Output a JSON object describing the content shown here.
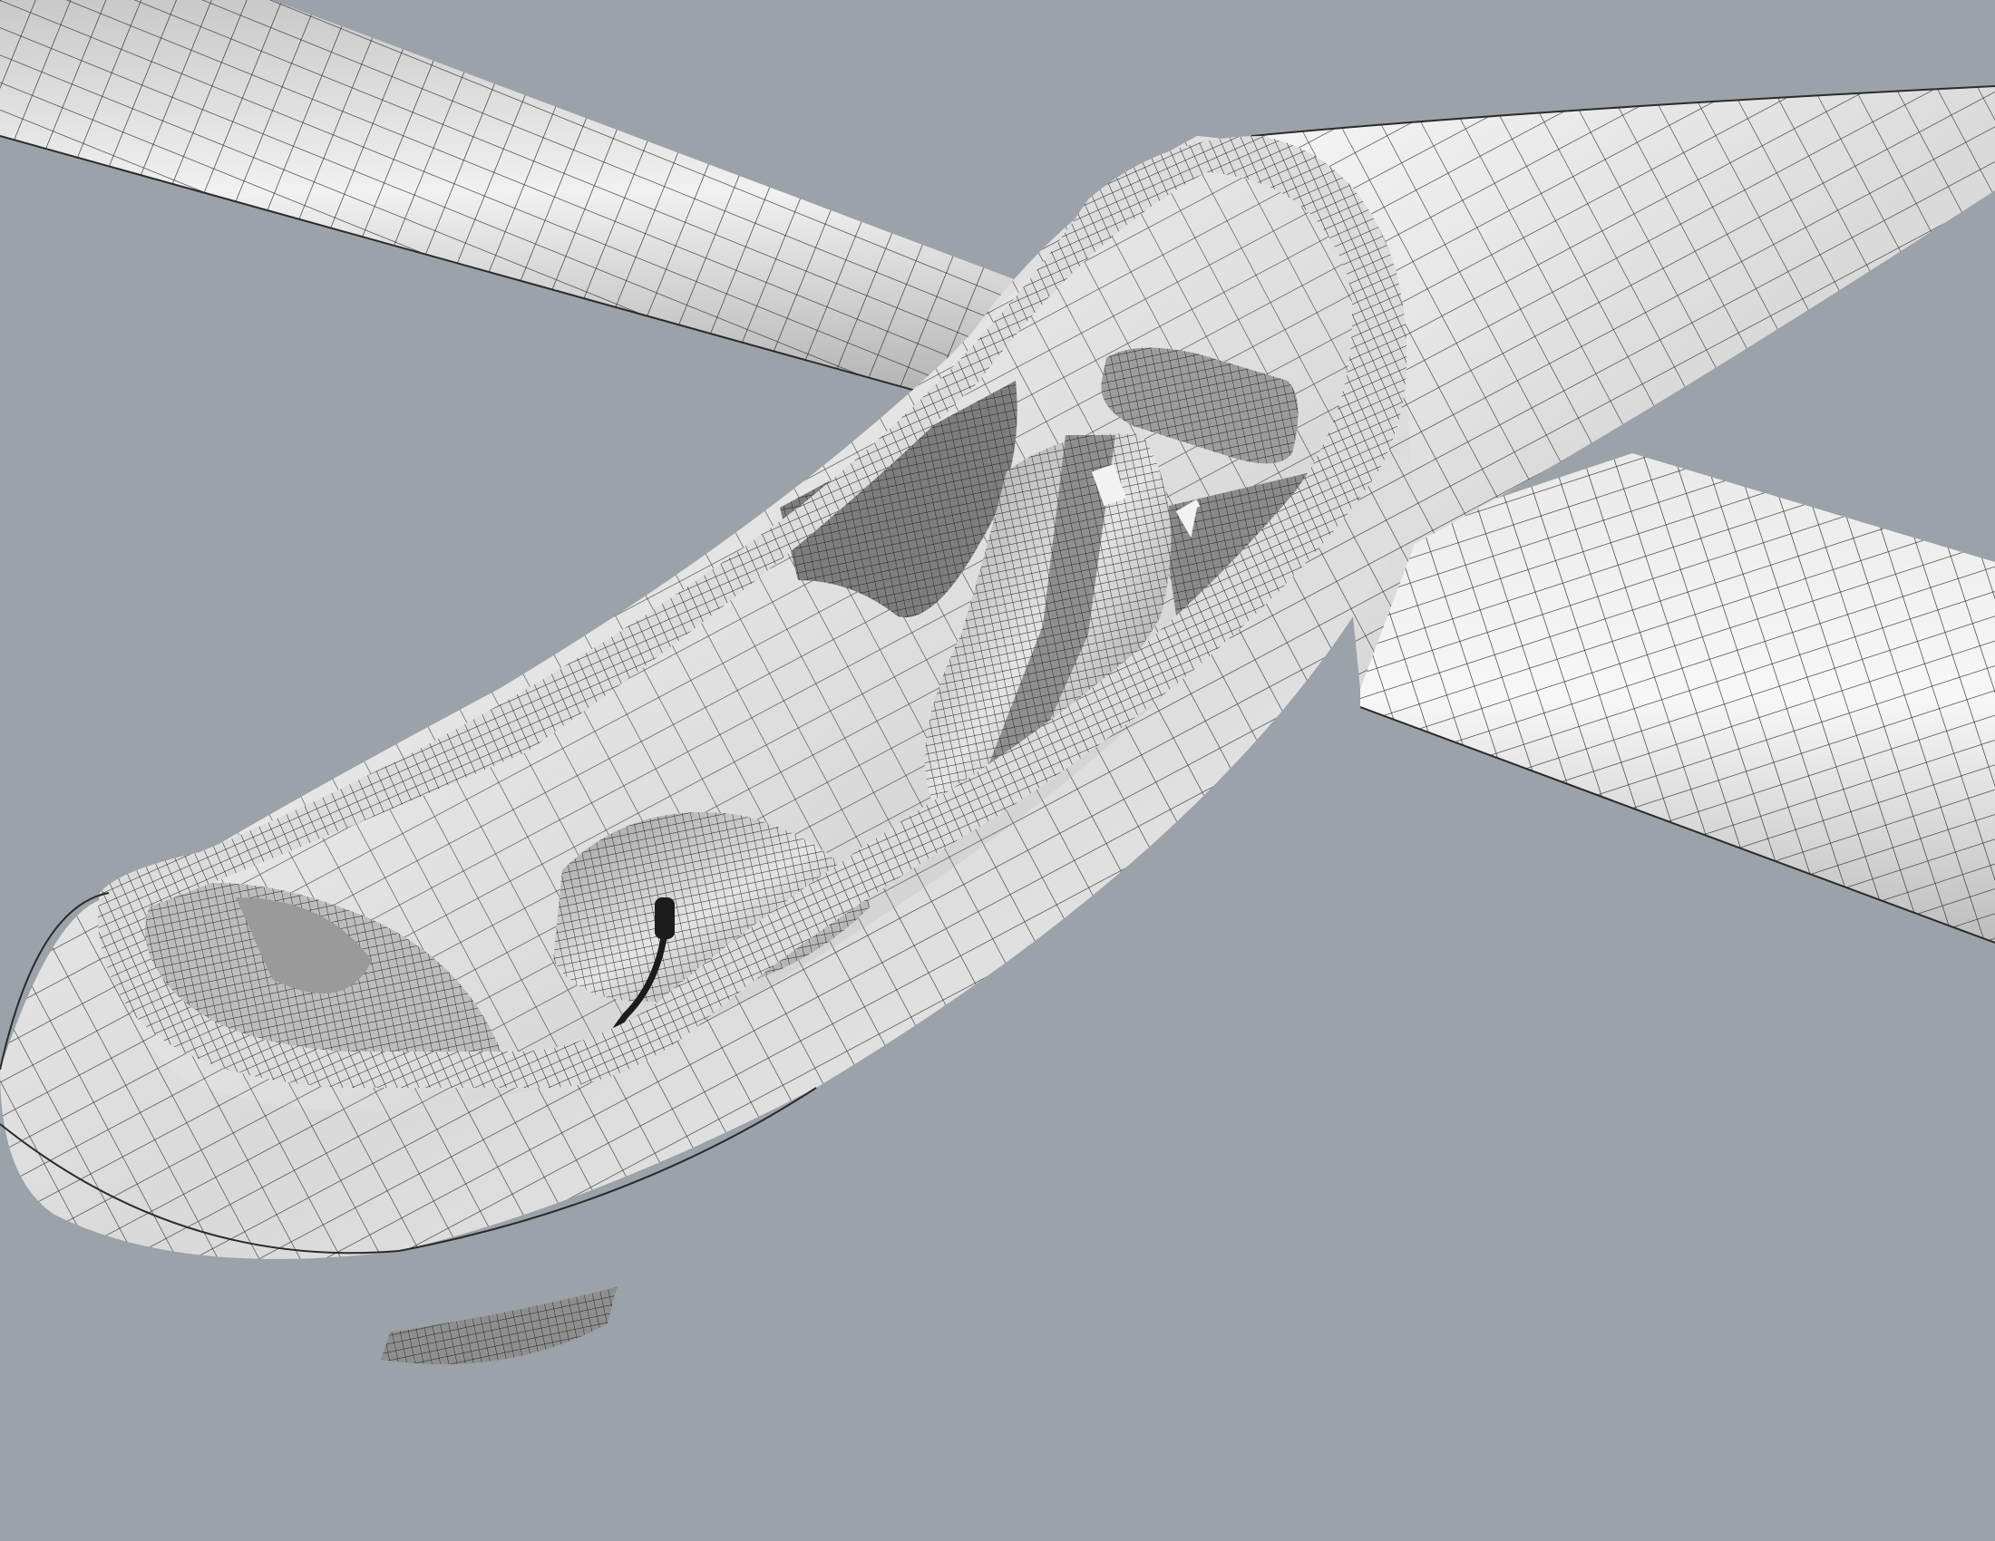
{
  "viewport": {
    "background": "#9ba2a9",
    "display_mode": "shaded-with-isocurves",
    "model": "glider",
    "visible_parts": [
      "left-wing",
      "right-wing",
      "fuselage-nose",
      "fuselage-tail",
      "cockpit-tub",
      "cockpit-rim",
      "instrument-panel",
      "pilot-seat",
      "headrest",
      "seat-harness",
      "control-stick",
      "side-panels",
      "wheel-fairing"
    ]
  },
  "colors": {
    "surface_light": "#f4f4f4",
    "surface_mid": "#d6d6d6",
    "surface_dark": "#9a9a9a",
    "wire": "#2a2a2a",
    "stick": "#1c1c1c"
  }
}
